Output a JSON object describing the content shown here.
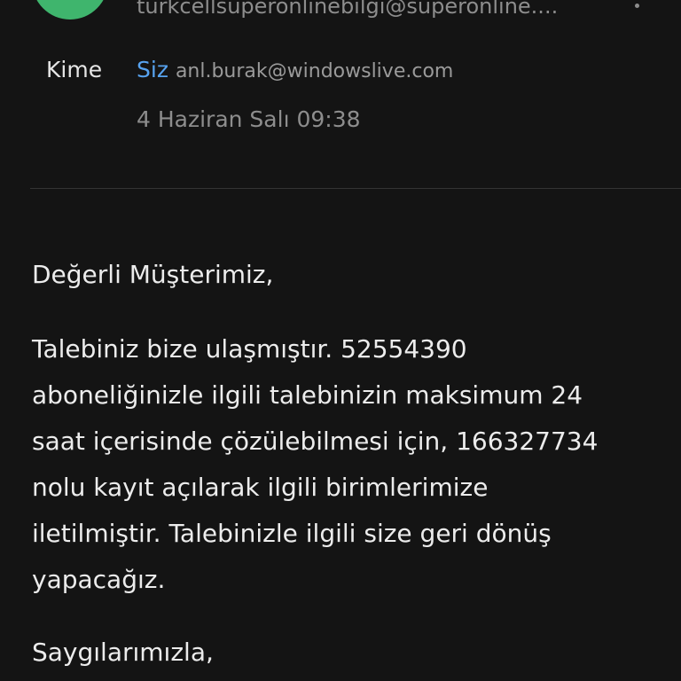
{
  "header": {
    "sender_email": "turkcellsuperonlinebilgi@superonline....",
    "to_label": "Kime",
    "to_you": "Siz",
    "to_email": "anl.burak@windowslive.com",
    "date": "4 Haziran Salı 09:38",
    "avatar_color": "#3fb56d",
    "more_icon": "more-vertical-icon"
  },
  "body": {
    "greeting": "Değerli Müşterimiz,",
    "message_lines": [
      "Talebiniz bize ulaşmıştır. 52554390",
      "aboneliğinizle ilgili talebinizin maksimum 24",
      "saat içerisinde çözülebilmesi için, 166327734",
      "nolu kayıt açılarak ilgili birimlerimize",
      "iletilmiştir. Talebinizle ilgili size geri dönüş",
      "yapacağız."
    ],
    "closing": "Saygılarımızla,"
  }
}
